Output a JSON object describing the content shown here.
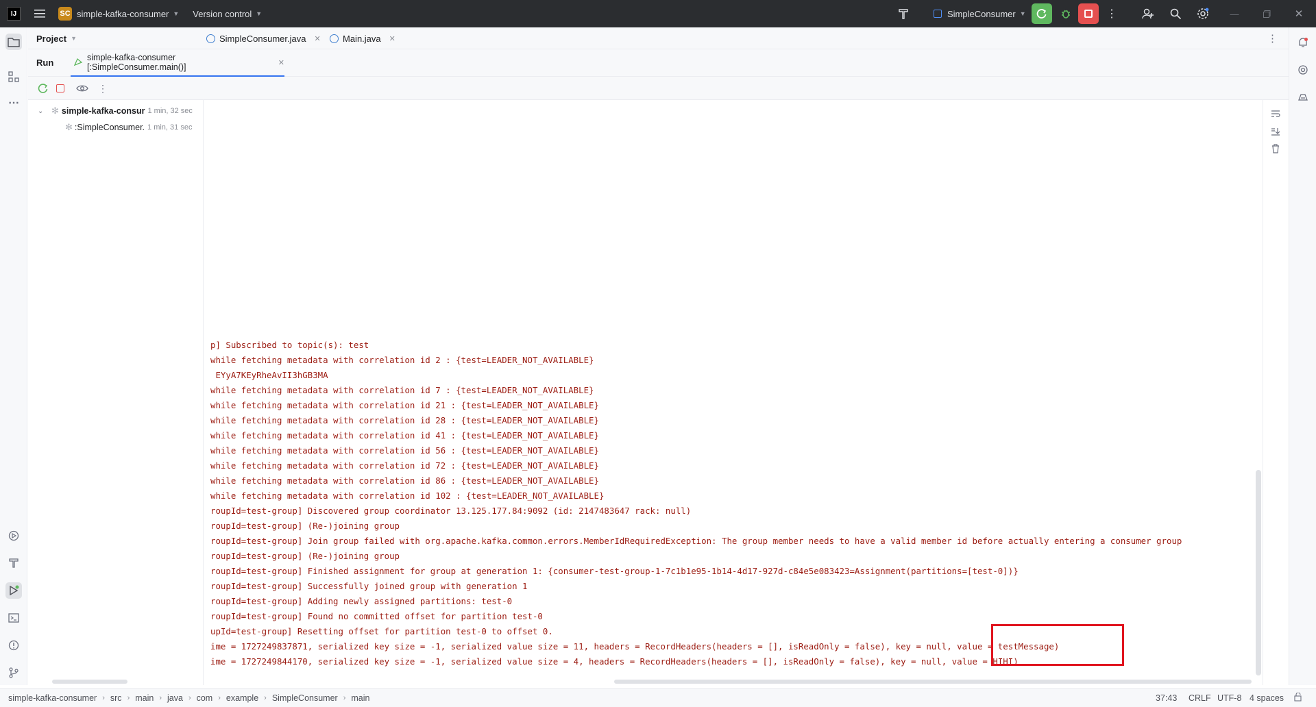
{
  "titlebar": {
    "logo": "IJ",
    "project_badge": "SC",
    "project_name": "simple-kafka-consumer",
    "version_control": "Version control",
    "run_config": "SimpleConsumer"
  },
  "left_panel": {
    "project_label": "Project"
  },
  "editor_tabs": [
    {
      "label": "SimpleConsumer.java"
    },
    {
      "label": "Main.java"
    }
  ],
  "run_panel": {
    "title": "Run",
    "tab_label": "simple-kafka-consumer [:SimpleConsumer.main()]"
  },
  "run_tree": [
    {
      "label": "simple-kafka-consur",
      "time": "1 min, 32 sec"
    },
    {
      "label": ":SimpleConsumer.",
      "time": "1 min, 31 sec"
    }
  ],
  "console_lines": [
    "p] Subscribed to topic(s): test",
    "while fetching metadata with correlation id 2 : {test=LEADER_NOT_AVAILABLE}",
    " EYyA7KEyRheAvII3hGB3MA",
    "while fetching metadata with correlation id 7 : {test=LEADER_NOT_AVAILABLE}",
    "while fetching metadata with correlation id 21 : {test=LEADER_NOT_AVAILABLE}",
    "while fetching metadata with correlation id 28 : {test=LEADER_NOT_AVAILABLE}",
    "while fetching metadata with correlation id 41 : {test=LEADER_NOT_AVAILABLE}",
    "while fetching metadata with correlation id 56 : {test=LEADER_NOT_AVAILABLE}",
    "while fetching metadata with correlation id 72 : {test=LEADER_NOT_AVAILABLE}",
    "while fetching metadata with correlation id 86 : {test=LEADER_NOT_AVAILABLE}",
    "while fetching metadata with correlation id 102 : {test=LEADER_NOT_AVAILABLE}",
    "roupId=test-group] Discovered group coordinator 13.125.177.84:9092 (id: 2147483647 rack: null)",
    "roupId=test-group] (Re-)joining group",
    "roupId=test-group] Join group failed with org.apache.kafka.common.errors.MemberIdRequiredException: The group member needs to have a valid member id before actually entering a consumer group",
    "roupId=test-group] (Re-)joining group",
    "roupId=test-group] Finished assignment for group at generation 1: {consumer-test-group-1-7c1b1e95-1b14-4d17-927d-c84e5e083423=Assignment(partitions=[test-0])}",
    "roupId=test-group] Successfully joined group with generation 1",
    "roupId=test-group] Adding newly assigned partitions: test-0",
    "roupId=test-group] Found no committed offset for partition test-0",
    "upId=test-group] Resetting offset for partition test-0 to offset 0.",
    "ime = 1727249837871, serialized key size = -1, serialized value size = 11, headers = RecordHeaders(headers = [], isReadOnly = false), key = null, value = testMessage)",
    "ime = 1727249844170, serialized key size = -1, serialized value size = 4, headers = RecordHeaders(headers = [], isReadOnly = false), key = null, value = HIHI)"
  ],
  "statusbar": {
    "breadcrumbs": [
      "simple-kafka-consumer",
      "src",
      "main",
      "java",
      "com",
      "example",
      "SimpleConsumer",
      "main"
    ],
    "position": "37:43",
    "line_sep": "CRLF",
    "encoding": "UTF-8",
    "indent": "4 spaces"
  },
  "colors": {
    "highlight_box": "#e0141e",
    "console_text": "#9c1c12",
    "run_green": "#5fb85f",
    "stop_red": "#e55050"
  }
}
